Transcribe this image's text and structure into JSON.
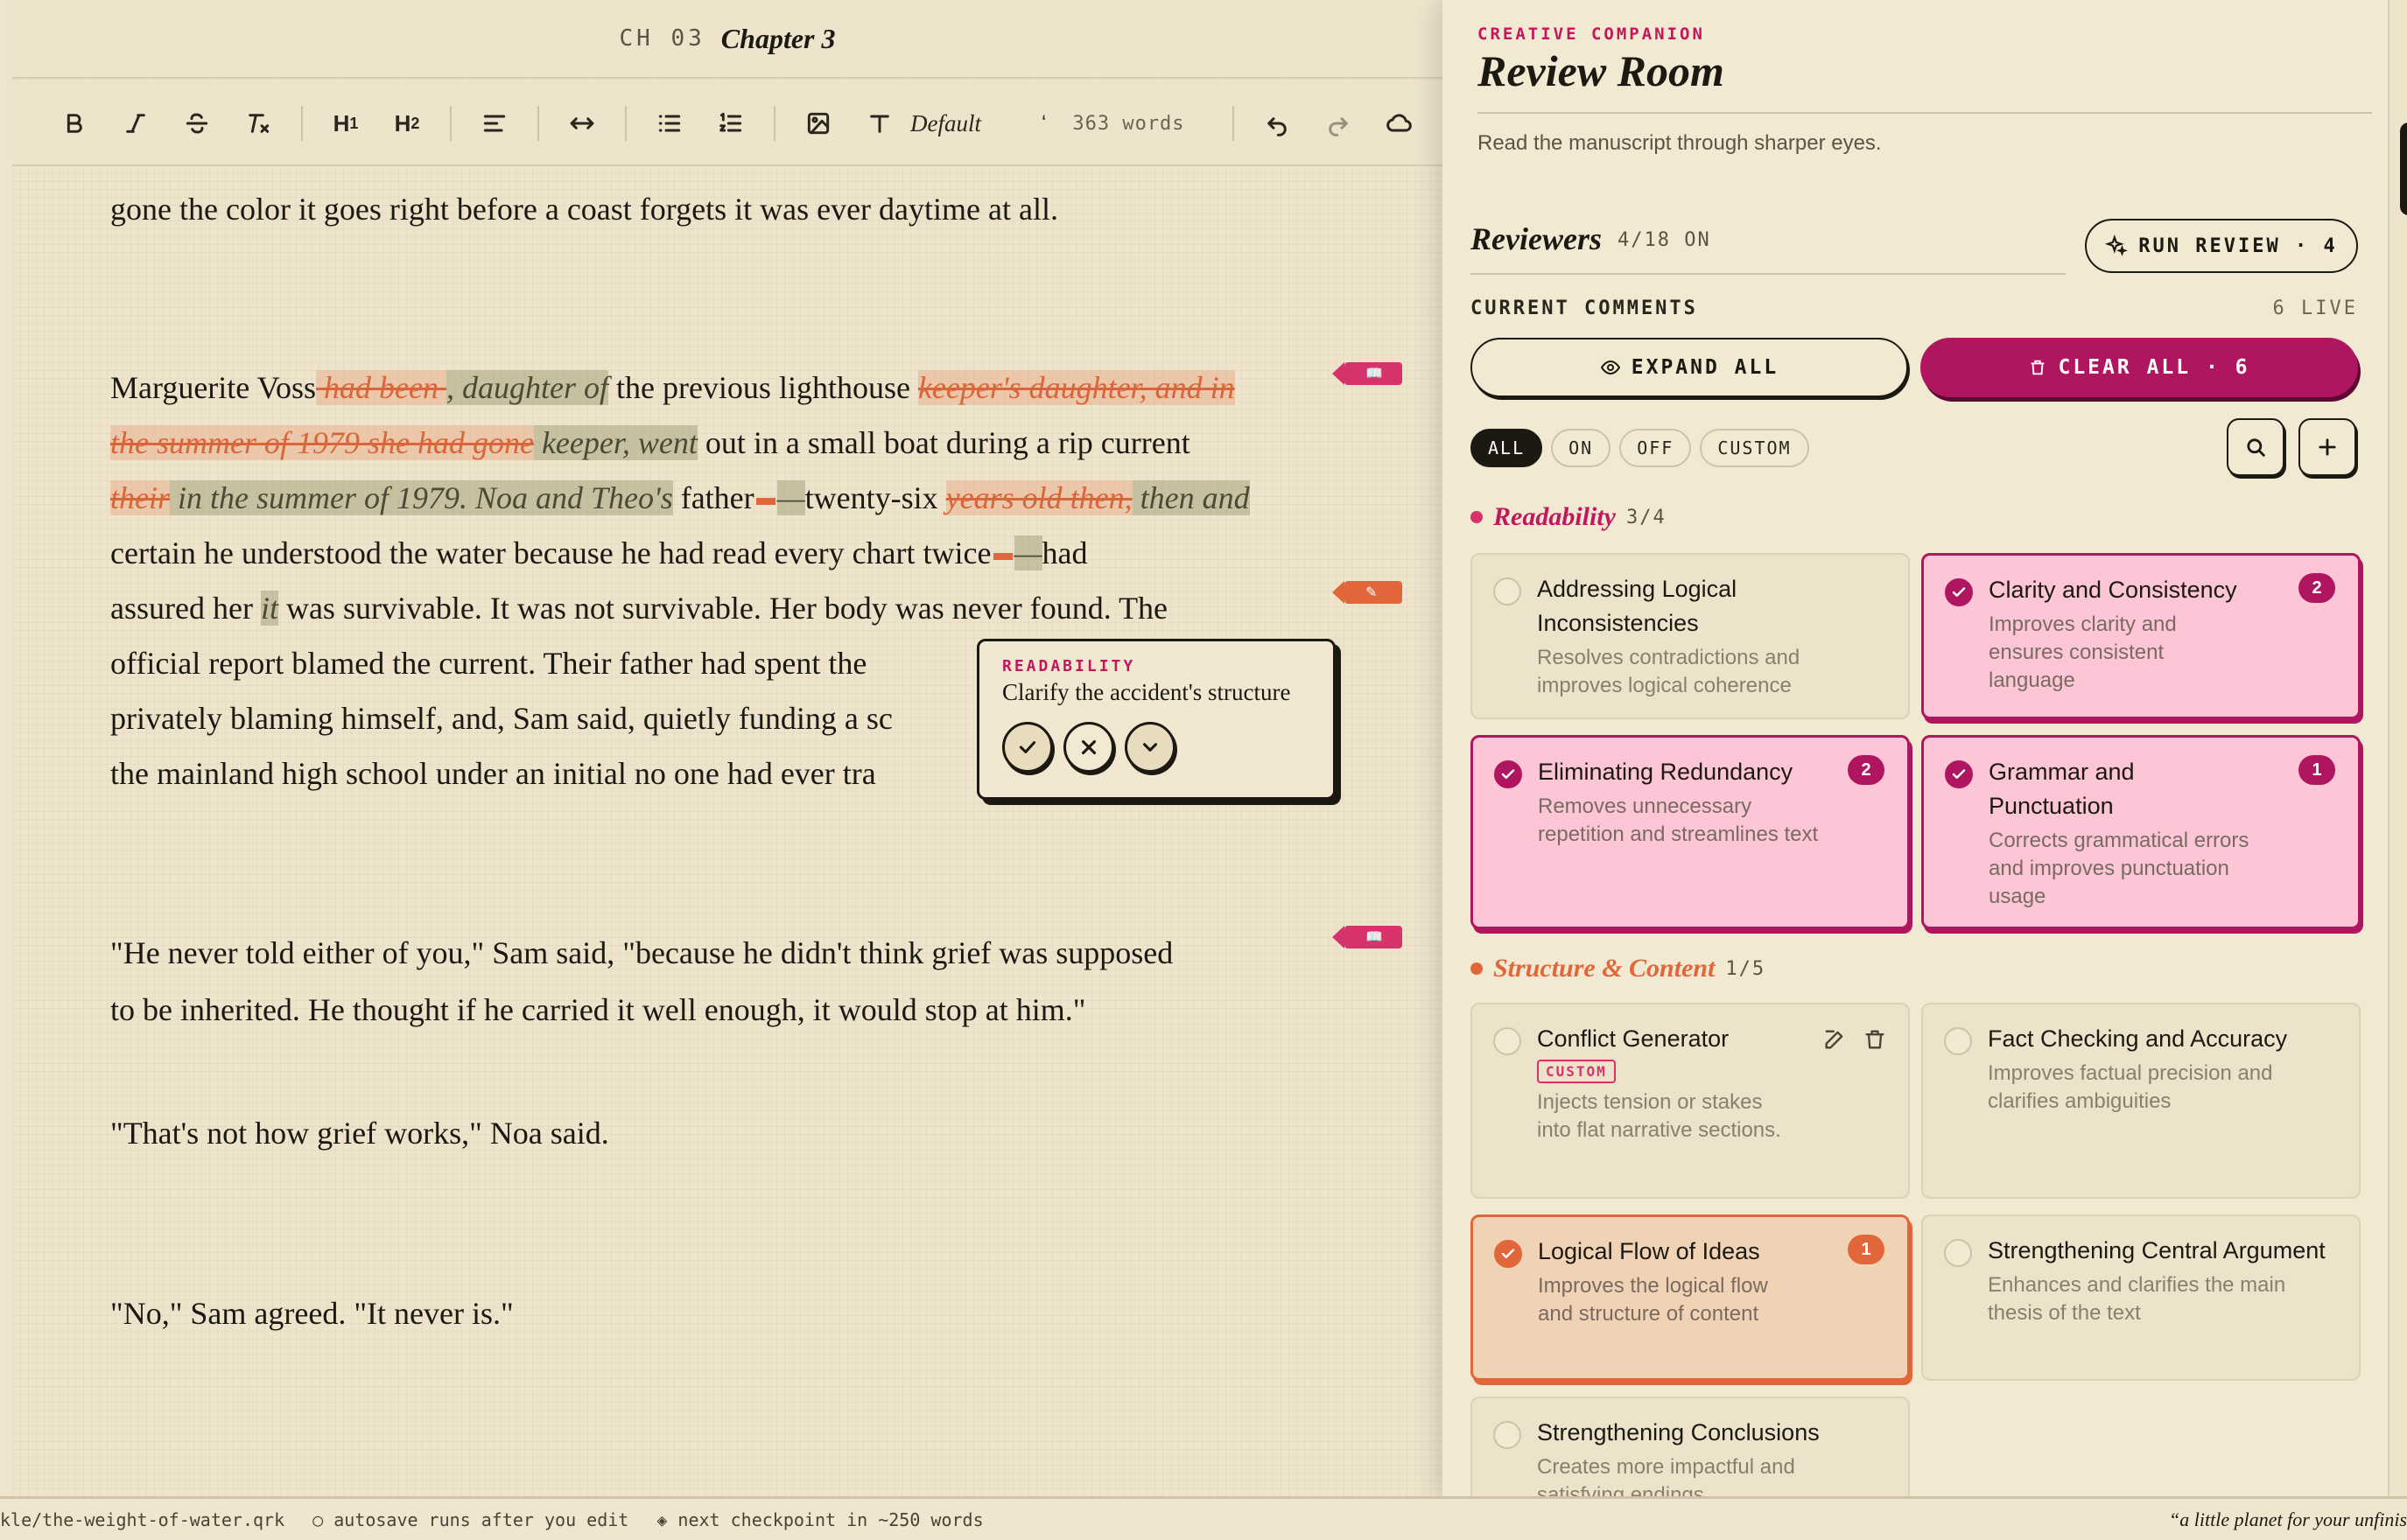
{
  "chapter": {
    "code": "CH 03",
    "title": "Chapter 3"
  },
  "toolbar": {
    "font": "Default",
    "font_caret": "‘",
    "word_count": "363 words",
    "h1": "H",
    "h1_sub": "1",
    "h2": "H",
    "h2_sub": "2"
  },
  "prose": {
    "l1": "gone the color it goes right before a coast forgets it was ever daytime at all.",
    "p2a": "Marguerite Voss",
    "p2a_del": " had been ",
    "p2a_ins": ", daughter of",
    "p2a_txt": " the previous lighthouse ",
    "p2a_del2": "keeper's daughter, and in",
    "p2b_del": "the summer of 1979 she had gone",
    "p2b_ins": " keeper, went",
    "p2b_txt": " out in a small boat during a rip current",
    "p2c_del": "their",
    "p2c_ins": " in the summer of 1979. Noa and Theo's",
    "p2c_txt": " father",
    "p2c_txt2": "twenty-six ",
    "p2c_del2": "years old then,",
    "p2c_ins2": " then and",
    "p2c_dash": "—",
    "p2d": "certain he understood the water because he had read every chart twice",
    "p2d_end": "had",
    "p2e_a": "assured her ",
    "p2e_ins": "it",
    "p2e_b": " was survivable. It was not survivable. Her body was never found. The",
    "p2f": "official report blamed the current. Their father had spent the",
    "p2g": "privately blaming himself, and, Sam said, quietly funding a sc",
    "p2h": "the mainland high school under an initial no one had ever tra",
    "p3a": "\"He never told either of you,\" Sam said, \"because he didn't think grief was supposed",
    "p3b": "to be inherited. He thought if he carried it well enough, it would stop at him.\"",
    "p4": "\"That's not how grief works,\" Noa said.",
    "p5": "\"No,\" Sam agreed. \"It never is.\""
  },
  "popover": {
    "category": "READABILITY",
    "message": "Clarify the accident's structure"
  },
  "panel": {
    "eyebrow": "CREATIVE COMPANION",
    "title": "Review Room",
    "subtitle": "Read the manuscript through sharper eyes.",
    "reviewers_label": "Reviewers",
    "reviewers_count": "4/18 ON",
    "run_review": "RUN REVIEW · 4",
    "current_comments": "CURRENT COMMENTS",
    "live": "6 LIVE",
    "expand_all": "EXPAND ALL",
    "clear_all": "CLEAR ALL · 6",
    "filters": [
      "ALL",
      "ON",
      "OFF",
      "CUSTOM"
    ],
    "groups": [
      {
        "name": "Readability",
        "count": "3/4",
        "color": "#d6336c"
      },
      {
        "name": "Structure & Content",
        "count": "1/5",
        "color": "#e1673a"
      }
    ],
    "cards": [
      {
        "title": "Addressing Logical Inconsistencies",
        "desc": "Resolves contradictions and improves logical coherence"
      },
      {
        "title": "Clarity and Consistency",
        "desc": "Improves clarity and ensures consistent language",
        "badge": "2"
      },
      {
        "title": "Eliminating Redundancy",
        "desc": "Removes unnecessary repetition and streamlines text",
        "badge": "2"
      },
      {
        "title": "Grammar and Punctuation",
        "desc": "Corrects grammatical errors and improves punctuation usage",
        "badge": "1"
      },
      {
        "title": "Conflict Generator",
        "tag": "CUSTOM",
        "desc": "Injects tension or stakes into flat narrative sections."
      },
      {
        "title": "Fact Checking and Accuracy",
        "desc": "Improves factual precision and clarifies ambiguities"
      },
      {
        "title": "Logical Flow of Ideas",
        "desc": "Improves the logical flow and structure of content",
        "badge": "1"
      },
      {
        "title": "Strengthening Central Argument",
        "desc": "Enhances and clarifies the main thesis of the text"
      },
      {
        "title": "Strengthening Conclusions",
        "desc": "Creates more impactful and satisfying endings"
      }
    ]
  },
  "status": {
    "file": "kle/the-weight-of-water.qrk",
    "autosave": "○ autosave runs after you edit",
    "checkpoint": "◈ next checkpoint in ~250 words",
    "quote": "“a little planet for your unfinis"
  },
  "colors": {
    "accent_pink": "#b01660",
    "accent_orange": "#e1673a",
    "paper": "#eee3cb"
  }
}
